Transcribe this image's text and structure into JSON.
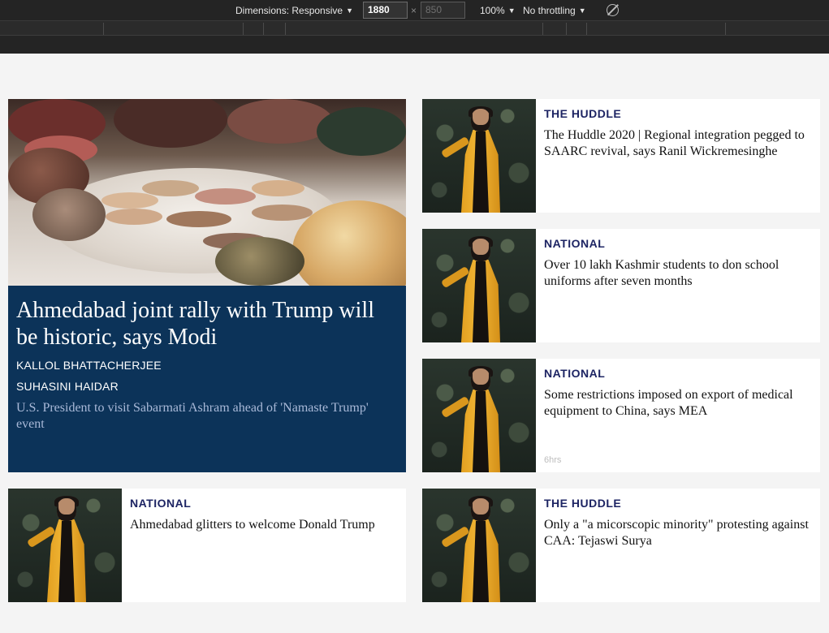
{
  "devtools": {
    "dimensions_label": "Dimensions: Responsive",
    "width_value": "1880",
    "times_symbol": "×",
    "height_value": "850",
    "zoom_label": "100%",
    "throttling_label": "No throttling",
    "caret": "▼",
    "rotate_icon": "rotate-icon"
  },
  "hero": {
    "title": "Ahmedabad joint rally with Trump will be historic, says Modi",
    "authors": [
      "KALLOL BHATTACHERJEE",
      "SUHASINI HAIDAR"
    ],
    "summary": "U.S. President to visit Sabarmati Ashram ahead of 'Namaste Trump' event",
    "background_color": "#0c3359"
  },
  "cards": [
    {
      "kicker": "THE HUDDLE",
      "headline": "The Huddle 2020 | Regional integration pegged to SAARC revival, says Ranil Wickremesinghe",
      "timestamp": ""
    },
    {
      "kicker": "NATIONAL",
      "headline": "Over 10 lakh Kashmir students to don school uniforms after seven months",
      "timestamp": ""
    },
    {
      "kicker": "NATIONAL",
      "headline": "Some restrictions imposed on export of medical equipment to China, says MEA",
      "timestamp": "6hrs"
    },
    {
      "kicker": "NATIONAL",
      "headline": "Ahmedabad glitters to welcome Donald Trump",
      "timestamp": ""
    },
    {
      "kicker": "THE HUDDLE",
      "headline": "Only a \"a micorscopic minority\" protesting against CAA: Tejaswi Surya",
      "timestamp": ""
    }
  ],
  "colors": {
    "kicker": "#1d2463",
    "page_background": "#f4f4f4",
    "devtools_background": "#242424"
  }
}
